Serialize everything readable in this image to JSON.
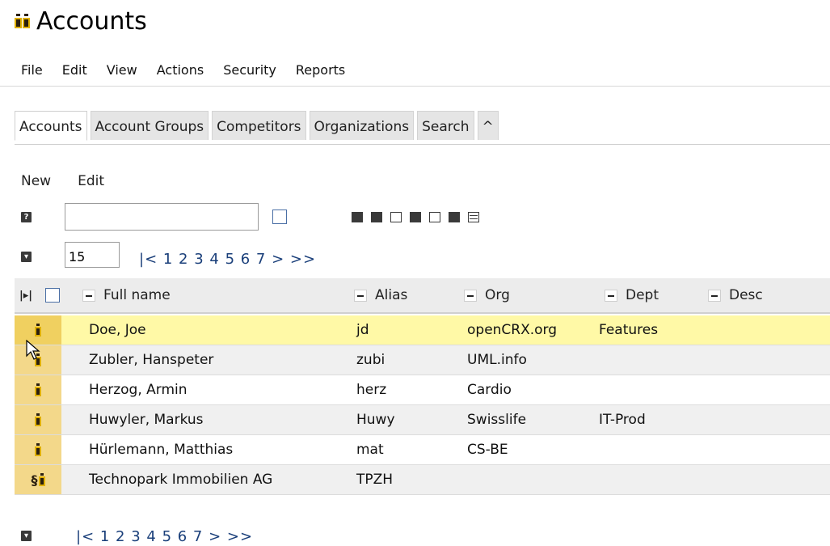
{
  "title": {
    "text": "Accounts",
    "icon": "accounts-icon"
  },
  "menu": [
    "File",
    "Edit",
    "View",
    "Actions",
    "Security",
    "Reports"
  ],
  "tabs": [
    "Accounts",
    "Account Groups",
    "Competitors",
    "Organizations",
    "Search",
    "^"
  ],
  "actions": {
    "new": "New",
    "edit": "Edit"
  },
  "filter": {
    "help_icon": "?",
    "value": "",
    "placeholder": ""
  },
  "paging": {
    "page_size": "15",
    "top_pager": "|< 1 2 3 4 5 6 7  >  >>",
    "bottom_pager": "|< 1 2 3 4 5 6 7  >  >>"
  },
  "grid": {
    "columns": [
      "Full name",
      "Alias",
      "Org",
      "Dept",
      "Desc"
    ],
    "rows": [
      {
        "name": "Doe, Joe",
        "alias": "jd",
        "org": "openCRX.org",
        "dept": "Features",
        "desc": "",
        "type": "person"
      },
      {
        "name": "Zubler, Hanspeter",
        "alias": "zubi",
        "org": "UML.info",
        "dept": "",
        "desc": "",
        "type": "person"
      },
      {
        "name": "Herzog, Armin",
        "alias": "herz",
        "org": "Cardio",
        "dept": "",
        "desc": "",
        "type": "person"
      },
      {
        "name": "Huwyler, Markus",
        "alias": "Huwy",
        "org": "Swisslife",
        "dept": "IT-Prod",
        "desc": "",
        "type": "person"
      },
      {
        "name": "Hürlemann, Matthias",
        "alias": "mat",
        "org": "CS-BE",
        "dept": "",
        "desc": "",
        "type": "person"
      },
      {
        "name": "Technopark Immobilien AG",
        "alias": "TPZH",
        "org": "",
        "dept": "",
        "desc": "",
        "type": "legal-entity"
      }
    ]
  },
  "colors": {
    "selected_row": "#fff9a6",
    "row_icon_bg": "#f3d88a",
    "link": "#1a3f7a"
  }
}
